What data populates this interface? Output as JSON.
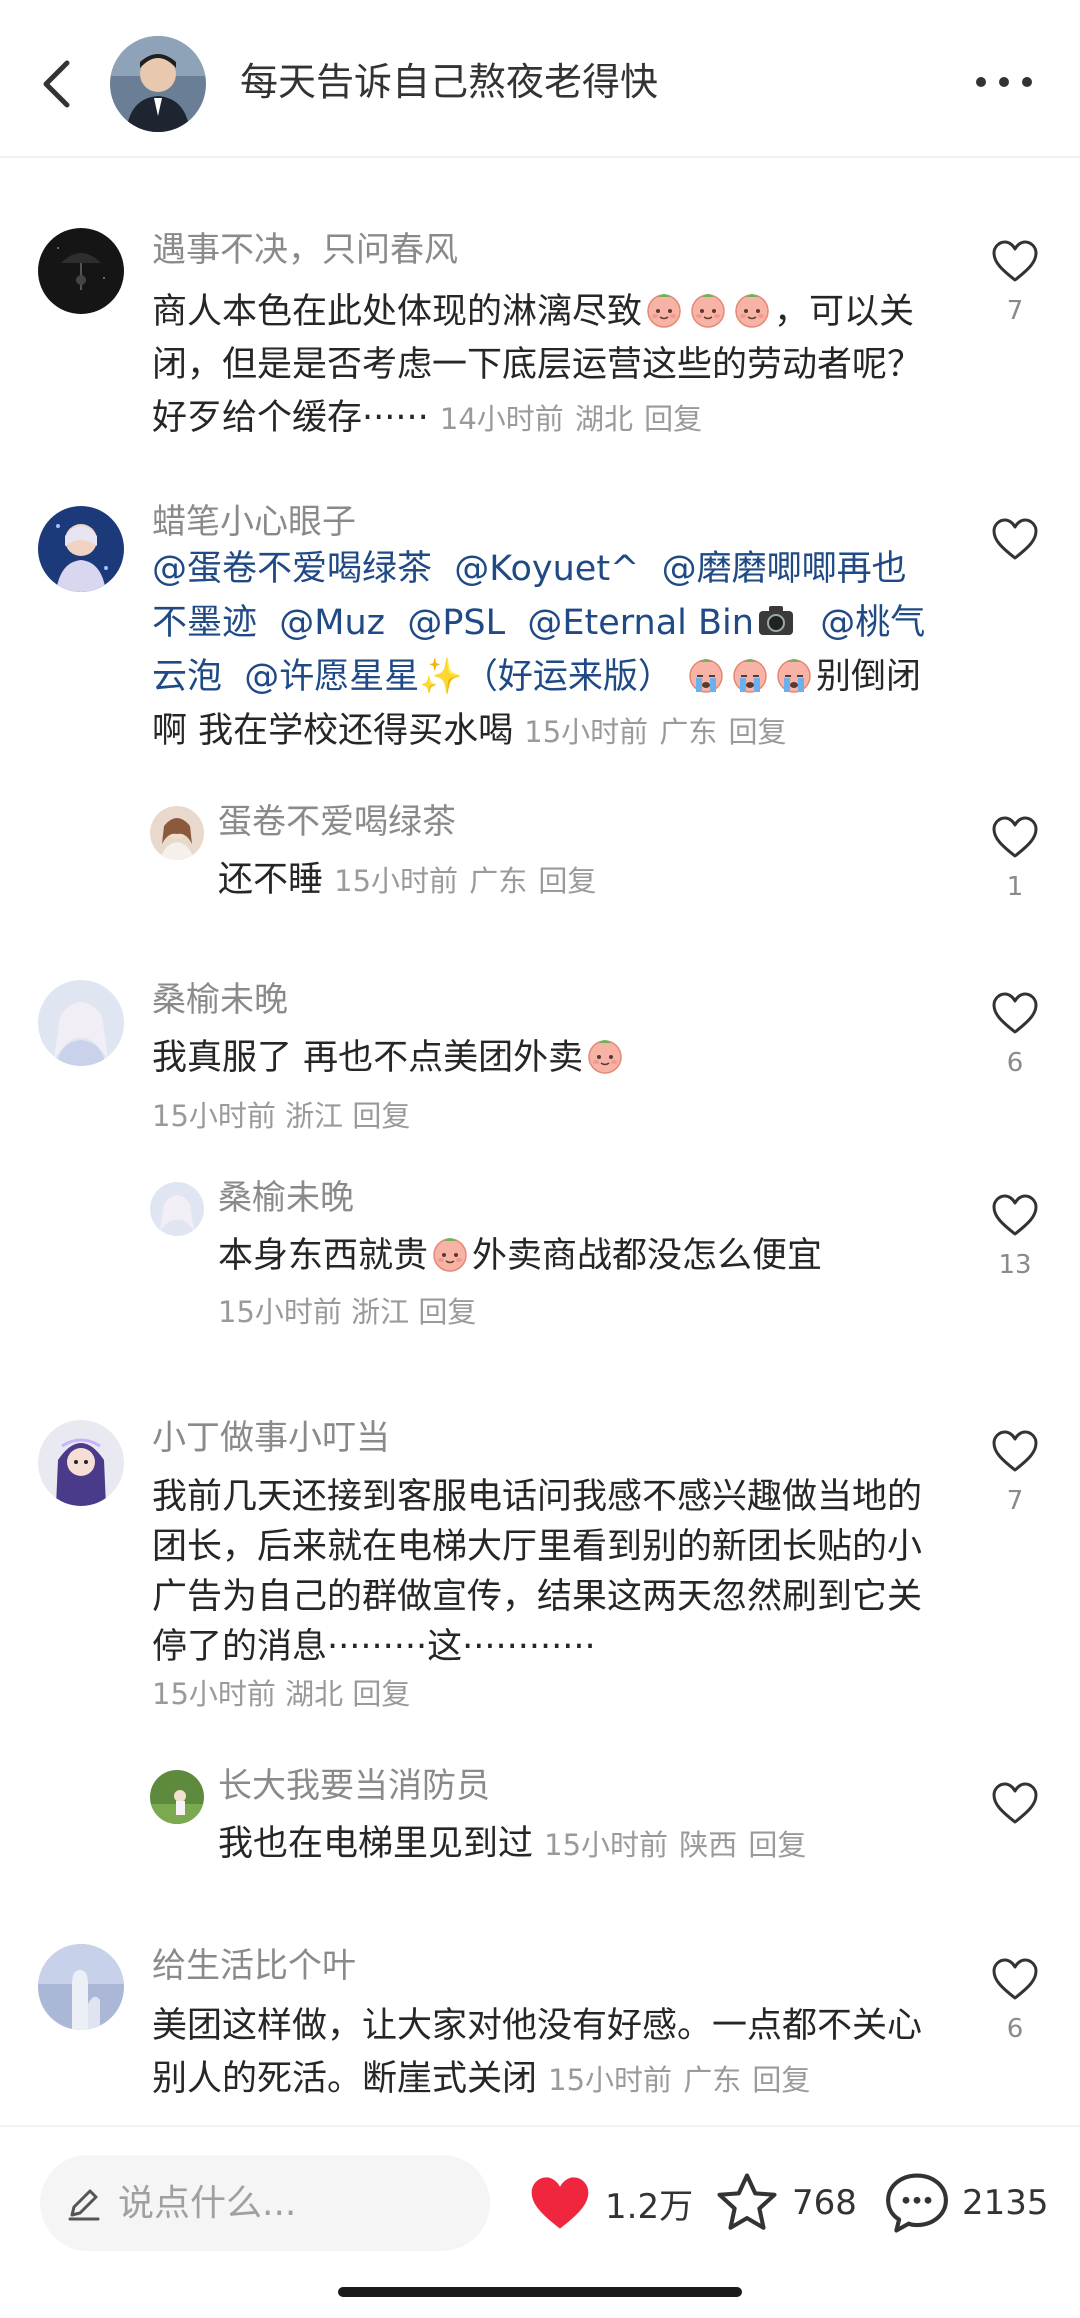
{
  "header": {
    "title": "每天告诉自己熬夜老得快"
  },
  "comments": [
    {
      "user": "遇事不决，只问春风",
      "text": "商人本色在此处体现的淋漓尽致",
      "text2": "，可以关闭，但是是否考虑一下底层运营这些的劳动者呢？好歹给个缓存······",
      "time": "14小时前",
      "location": "湖北",
      "reply": "回复",
      "likes": "7"
    },
    {
      "user": "蜡笔小心眼子",
      "mentions": [
        "@蛋卷不爱喝绿茶",
        "@Koyuet^",
        "@磨磨唧唧再也不墨迹",
        "@Muz",
        "@PSL",
        "@Eternal Bin",
        "@桃气云泡",
        "@许愿星星✨（好运来版）"
      ],
      "text": "别倒闭啊 我在学校还得买水喝",
      "time": "15小时前",
      "location": "广东",
      "reply": "回复",
      "likes": ""
    },
    {
      "user": "蛋卷不爱喝绿茶",
      "text": "还不睡",
      "time": "15小时前",
      "location": "广东",
      "reply": "回复",
      "likes": "1"
    },
    {
      "user": "桑榆未晚",
      "text": "我真服了 再也不点美团外卖",
      "time": "15小时前",
      "location": "浙江",
      "reply": "回复",
      "likes": "6"
    },
    {
      "user": "桑榆未晚",
      "text": "本身东西就贵",
      "text2": "外卖商战都没怎么便宜",
      "time": "15小时前",
      "location": "浙江",
      "reply": "回复",
      "likes": "13"
    },
    {
      "user": "小丁做事小叮当",
      "text": "我前几天还接到客服电话问我感不感兴趣做当地的团长，后来就在电梯大厅里看到别的新团长贴的小广告为自己的群做宣传，结果这两天忽然刷到它关停了的消息·········这············",
      "time": "15小时前",
      "location": "湖北",
      "reply": "回复",
      "likes": "7"
    },
    {
      "user": "长大我要当消防员",
      "text": "我也在电梯里见到过",
      "time": "15小时前",
      "location": "陕西",
      "reply": "回复",
      "likes": ""
    },
    {
      "user": "给生活比个叶",
      "text": "美团这样做，让大家对他没有好感。一点都不关心别人的死活。断崖式关闭",
      "time": "15小时前",
      "location": "广东",
      "reply": "回复",
      "likes": "6"
    }
  ],
  "bottom": {
    "input_placeholder": "说点什么...",
    "likes": "1.2万",
    "favorites": "768",
    "comments": "2135"
  },
  "colors": {
    "heart": "#f0263e",
    "mention": "#1f4a85",
    "meta": "#9a9a9a"
  }
}
